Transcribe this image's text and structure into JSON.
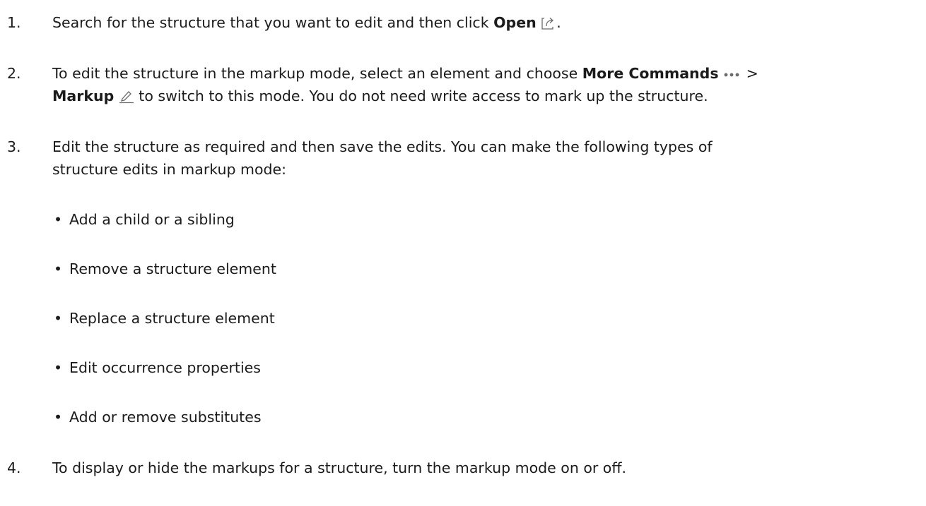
{
  "steps": [
    {
      "number": "1.",
      "text_before": "Search for the structure that you want to edit and then click ",
      "bold": "Open",
      "icon": "open-icon",
      "text_after": "."
    },
    {
      "number": "2.",
      "text_before": "To edit the structure in the markup mode, select an element and choose ",
      "bold_more": "More Commands",
      "more_icon": "more-commands-icon",
      "separator": ">",
      "bold_markup": "Markup",
      "markup_icon": "markup-icon",
      "text_after": " to switch to this mode. You do not need write access to mark up the structure."
    },
    {
      "number": "3.",
      "line1": "Edit the structure as required and then save the edits. You can make the following types of",
      "line2": "structure edits in markup mode:",
      "bullet_char": "•",
      "bullets": [
        "Add a child or a sibling",
        "Remove a structure element",
        "Replace a structure element",
        "Edit occurrence properties",
        "Add or remove substitutes"
      ]
    },
    {
      "number": "4.",
      "text": "To display or hide the markups for a structure, turn the markup mode on or off."
    }
  ],
  "colors": {
    "text": "#1b1b1b",
    "icon": "#6b6b6b"
  }
}
